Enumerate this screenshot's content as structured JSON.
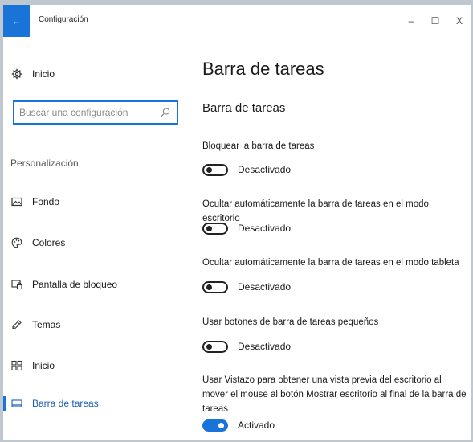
{
  "window": {
    "title": "Configuración",
    "back_icon": "←",
    "minimize_icon": "–",
    "maximize_icon": "☐",
    "close_icon": "X",
    "accent_color": "#1a73d9"
  },
  "sidebar": {
    "home_label": "Inicio",
    "search_placeholder": "Buscar una configuración",
    "section_label": "Personalización",
    "items": [
      {
        "label": "Fondo",
        "icon": "image-icon"
      },
      {
        "label": "Colores",
        "icon": "palette-icon"
      },
      {
        "label": "Pantalla de bloqueo",
        "icon": "lock-screen-icon"
      },
      {
        "label": "Temas",
        "icon": "brush-icon"
      },
      {
        "label": "Inicio",
        "icon": "start-grid-icon"
      },
      {
        "label": "Barra de tareas",
        "icon": "taskbar-icon",
        "active": true
      }
    ]
  },
  "main": {
    "page_title": "Barra de tareas",
    "section_title": "Barra de tareas",
    "settings": [
      {
        "label": "Bloquear la barra de tareas",
        "state": "Desactivado",
        "on": false
      },
      {
        "label": "Ocultar automáticamente la barra de tareas en el modo escritorio",
        "state": "Desactivado",
        "on": false
      },
      {
        "label": "Ocultar automáticamente la barra de tareas en el modo tableta",
        "state": "Desactivado",
        "on": false
      },
      {
        "label": "Usar botones de barra de tareas pequeños",
        "state": "Desactivado",
        "on": false
      },
      {
        "label": "Usar Vistazo para obtener una vista previa del escritorio al mover el mouse al botón Mostrar escritorio al final de la barra de tareas",
        "state": "Activado",
        "on": true
      }
    ]
  }
}
